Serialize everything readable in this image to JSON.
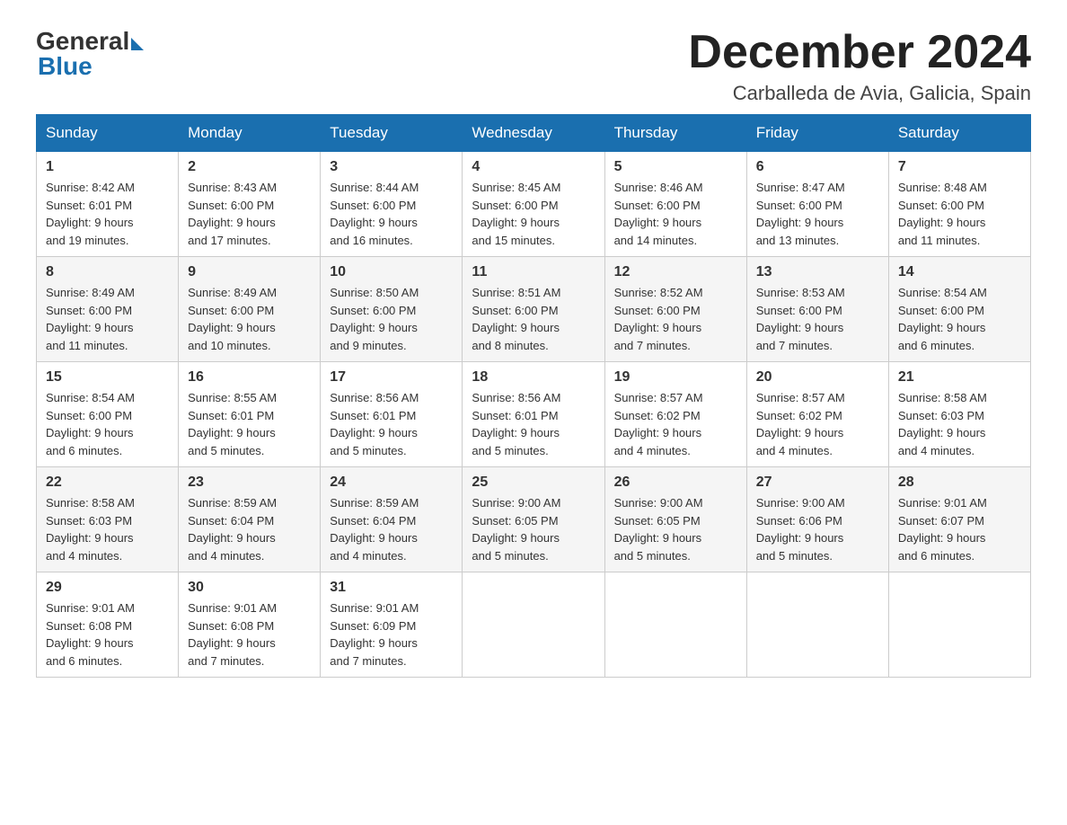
{
  "logo": {
    "general": "General",
    "blue": "Blue"
  },
  "title": "December 2024",
  "subtitle": "Carballeda de Avia, Galicia, Spain",
  "weekdays": [
    "Sunday",
    "Monday",
    "Tuesday",
    "Wednesday",
    "Thursday",
    "Friday",
    "Saturday"
  ],
  "weeks": [
    [
      {
        "num": "1",
        "sunrise": "8:42 AM",
        "sunset": "6:01 PM",
        "daylight": "9 hours and 19 minutes."
      },
      {
        "num": "2",
        "sunrise": "8:43 AM",
        "sunset": "6:00 PM",
        "daylight": "9 hours and 17 minutes."
      },
      {
        "num": "3",
        "sunrise": "8:44 AM",
        "sunset": "6:00 PM",
        "daylight": "9 hours and 16 minutes."
      },
      {
        "num": "4",
        "sunrise": "8:45 AM",
        "sunset": "6:00 PM",
        "daylight": "9 hours and 15 minutes."
      },
      {
        "num": "5",
        "sunrise": "8:46 AM",
        "sunset": "6:00 PM",
        "daylight": "9 hours and 14 minutes."
      },
      {
        "num": "6",
        "sunrise": "8:47 AM",
        "sunset": "6:00 PM",
        "daylight": "9 hours and 13 minutes."
      },
      {
        "num": "7",
        "sunrise": "8:48 AM",
        "sunset": "6:00 PM",
        "daylight": "9 hours and 11 minutes."
      }
    ],
    [
      {
        "num": "8",
        "sunrise": "8:49 AM",
        "sunset": "6:00 PM",
        "daylight": "9 hours and 11 minutes."
      },
      {
        "num": "9",
        "sunrise": "8:49 AM",
        "sunset": "6:00 PM",
        "daylight": "9 hours and 10 minutes."
      },
      {
        "num": "10",
        "sunrise": "8:50 AM",
        "sunset": "6:00 PM",
        "daylight": "9 hours and 9 minutes."
      },
      {
        "num": "11",
        "sunrise": "8:51 AM",
        "sunset": "6:00 PM",
        "daylight": "9 hours and 8 minutes."
      },
      {
        "num": "12",
        "sunrise": "8:52 AM",
        "sunset": "6:00 PM",
        "daylight": "9 hours and 7 minutes."
      },
      {
        "num": "13",
        "sunrise": "8:53 AM",
        "sunset": "6:00 PM",
        "daylight": "9 hours and 7 minutes."
      },
      {
        "num": "14",
        "sunrise": "8:54 AM",
        "sunset": "6:00 PM",
        "daylight": "9 hours and 6 minutes."
      }
    ],
    [
      {
        "num": "15",
        "sunrise": "8:54 AM",
        "sunset": "6:00 PM",
        "daylight": "9 hours and 6 minutes."
      },
      {
        "num": "16",
        "sunrise": "8:55 AM",
        "sunset": "6:01 PM",
        "daylight": "9 hours and 5 minutes."
      },
      {
        "num": "17",
        "sunrise": "8:56 AM",
        "sunset": "6:01 PM",
        "daylight": "9 hours and 5 minutes."
      },
      {
        "num": "18",
        "sunrise": "8:56 AM",
        "sunset": "6:01 PM",
        "daylight": "9 hours and 5 minutes."
      },
      {
        "num": "19",
        "sunrise": "8:57 AM",
        "sunset": "6:02 PM",
        "daylight": "9 hours and 4 minutes."
      },
      {
        "num": "20",
        "sunrise": "8:57 AM",
        "sunset": "6:02 PM",
        "daylight": "9 hours and 4 minutes."
      },
      {
        "num": "21",
        "sunrise": "8:58 AM",
        "sunset": "6:03 PM",
        "daylight": "9 hours and 4 minutes."
      }
    ],
    [
      {
        "num": "22",
        "sunrise": "8:58 AM",
        "sunset": "6:03 PM",
        "daylight": "9 hours and 4 minutes."
      },
      {
        "num": "23",
        "sunrise": "8:59 AM",
        "sunset": "6:04 PM",
        "daylight": "9 hours and 4 minutes."
      },
      {
        "num": "24",
        "sunrise": "8:59 AM",
        "sunset": "6:04 PM",
        "daylight": "9 hours and 4 minutes."
      },
      {
        "num": "25",
        "sunrise": "9:00 AM",
        "sunset": "6:05 PM",
        "daylight": "9 hours and 5 minutes."
      },
      {
        "num": "26",
        "sunrise": "9:00 AM",
        "sunset": "6:05 PM",
        "daylight": "9 hours and 5 minutes."
      },
      {
        "num": "27",
        "sunrise": "9:00 AM",
        "sunset": "6:06 PM",
        "daylight": "9 hours and 5 minutes."
      },
      {
        "num": "28",
        "sunrise": "9:01 AM",
        "sunset": "6:07 PM",
        "daylight": "9 hours and 6 minutes."
      }
    ],
    [
      {
        "num": "29",
        "sunrise": "9:01 AM",
        "sunset": "6:08 PM",
        "daylight": "9 hours and 6 minutes."
      },
      {
        "num": "30",
        "sunrise": "9:01 AM",
        "sunset": "6:08 PM",
        "daylight": "9 hours and 7 minutes."
      },
      {
        "num": "31",
        "sunrise": "9:01 AM",
        "sunset": "6:09 PM",
        "daylight": "9 hours and 7 minutes."
      },
      null,
      null,
      null,
      null
    ]
  ],
  "labels": {
    "sunrise": "Sunrise:",
    "sunset": "Sunset:",
    "daylight": "Daylight:"
  }
}
